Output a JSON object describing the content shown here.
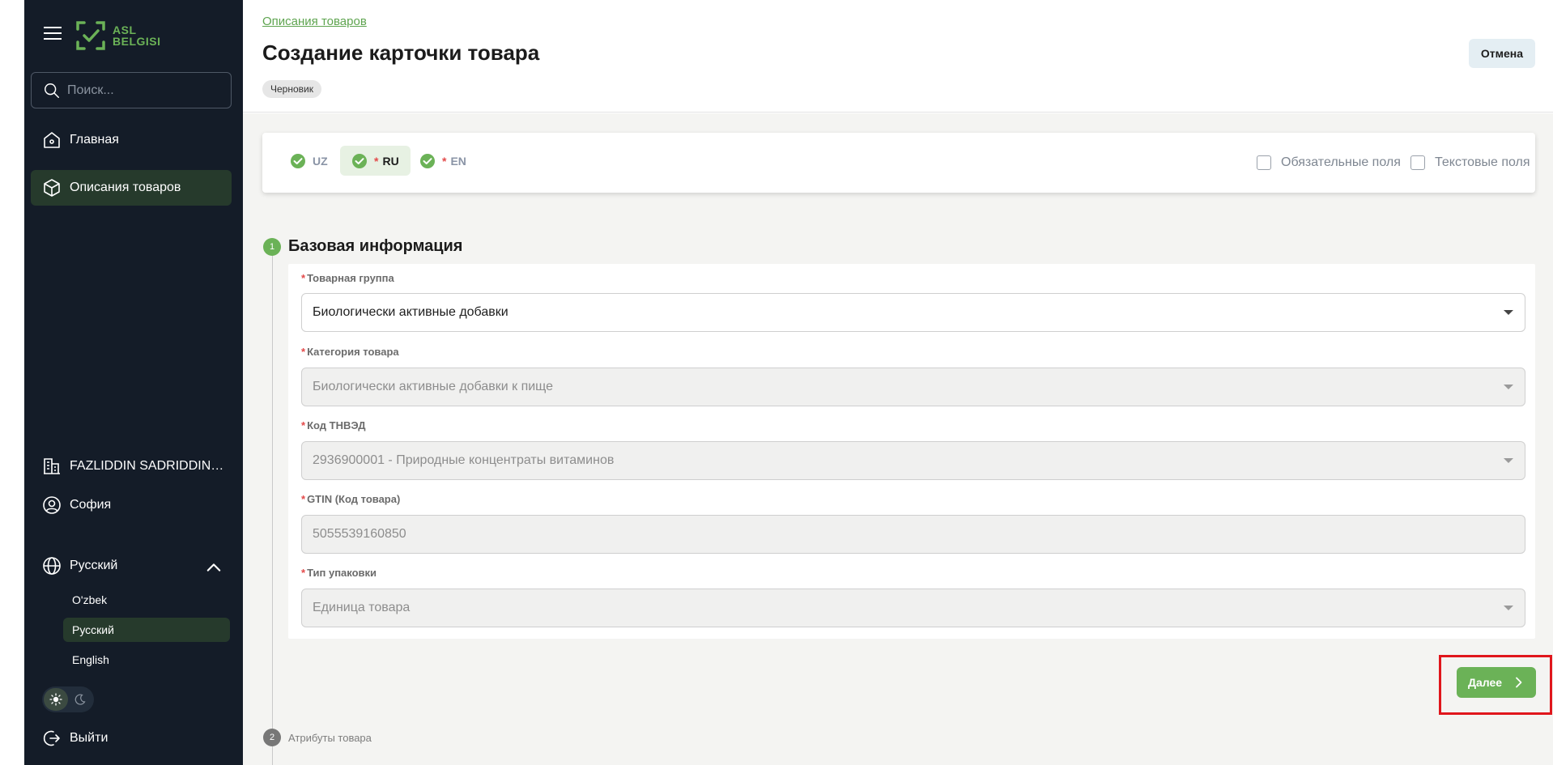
{
  "sidebar": {
    "logo_text_line1": "ASL",
    "logo_text_line2": "BELGISI",
    "search_placeholder": "Поиск...",
    "nav": {
      "home": "Главная",
      "products": "Описания товаров"
    },
    "company": "FAZLIDDIN SADRIDDINOV...",
    "user": "София",
    "language": {
      "current": "Русский",
      "options": [
        "O'zbek",
        "Русский",
        "English"
      ]
    },
    "logout": "Выйти"
  },
  "header": {
    "breadcrumb": "Описания товаров",
    "title": "Создание карточки товара",
    "status": "Черновик",
    "cancel_label": "Отмена"
  },
  "lang_tabs": [
    {
      "code": "UZ",
      "required": false,
      "active": false
    },
    {
      "code": "RU",
      "required": true,
      "active": true
    },
    {
      "code": "EN",
      "required": true,
      "active": false
    }
  ],
  "required_marker": "*",
  "filters": {
    "required_fields": "Обязательные поля",
    "text_fields": "Текстовые поля"
  },
  "steps": {
    "step1": {
      "number": "1",
      "title": "Базовая информация"
    },
    "step2": {
      "number": "2",
      "title": "Атрибуты товара"
    }
  },
  "form": {
    "product_group": {
      "label": "Товарная группа",
      "value": "Биологически активные добавки"
    },
    "category": {
      "label": "Категория товара",
      "value": "Биологически активные добавки к пище"
    },
    "tnved": {
      "label": "Код ТНВЭД",
      "value": "2936900001 - Природные концентраты витаминов"
    },
    "gtin": {
      "label": "GTIN (Код товара)",
      "value": "5055539160850"
    },
    "package_type": {
      "label": "Тип упаковки",
      "value": "Единица товара"
    }
  },
  "next_label": "Далее",
  "colors": {
    "sidebar_bg": "#141c28",
    "accent_green": "#6bb257",
    "highlight_red": "#e0161c"
  }
}
